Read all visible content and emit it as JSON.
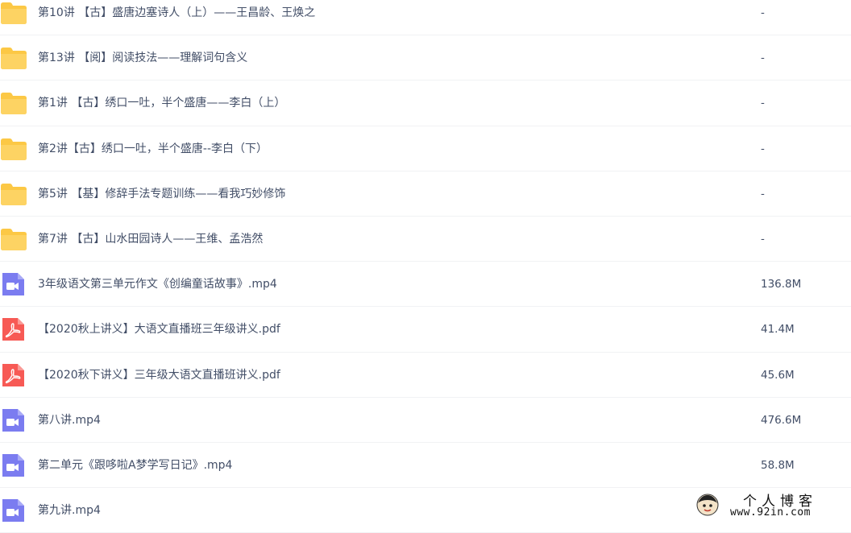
{
  "files": [
    {
      "type": "folder",
      "name": "第10讲 【古】盛唐边塞诗人（上）——王昌龄、王焕之",
      "size": "-"
    },
    {
      "type": "folder",
      "name": "第13讲 【阅】阅读技法——理解词句含义",
      "size": "-"
    },
    {
      "type": "folder",
      "name": "第1讲 【古】绣口一吐，半个盛唐——李白（上）",
      "size": "-"
    },
    {
      "type": "folder",
      "name": "第2讲【古】绣口一吐，半个盛唐--李白（下）",
      "size": "-"
    },
    {
      "type": "folder",
      "name": "第5讲 【基】修辞手法专题训练——看我巧妙修饰",
      "size": "-"
    },
    {
      "type": "folder",
      "name": "第7讲 【古】山水田园诗人——王维、孟浩然",
      "size": "-"
    },
    {
      "type": "video",
      "name": "3年级语文第三单元作文《创编童话故事》.mp4",
      "size": "136.8M"
    },
    {
      "type": "pdf",
      "name": "【2020秋上讲义】大语文直播班三年级讲义.pdf",
      "size": "41.4M"
    },
    {
      "type": "pdf",
      "name": "【2020秋下讲义】三年级大语文直播班讲义.pdf",
      "size": "45.6M"
    },
    {
      "type": "video",
      "name": "第八讲.mp4",
      "size": "476.6M"
    },
    {
      "type": "video",
      "name": "第二单元《跟哆啦A梦学写日记》.mp4",
      "size": "58.8M"
    },
    {
      "type": "video",
      "name": "第九讲.mp4",
      "size": ""
    }
  ],
  "icons": {
    "folder": "folder-icon",
    "video": "video-file-icon",
    "pdf": "pdf-file-icon"
  },
  "colors": {
    "folder": "#fcc845",
    "video": "#7b7cf0",
    "pdf": "#f75a55",
    "text": "#424e67"
  },
  "watermark": {
    "title": "个人博客",
    "url": "www.92in.com"
  }
}
